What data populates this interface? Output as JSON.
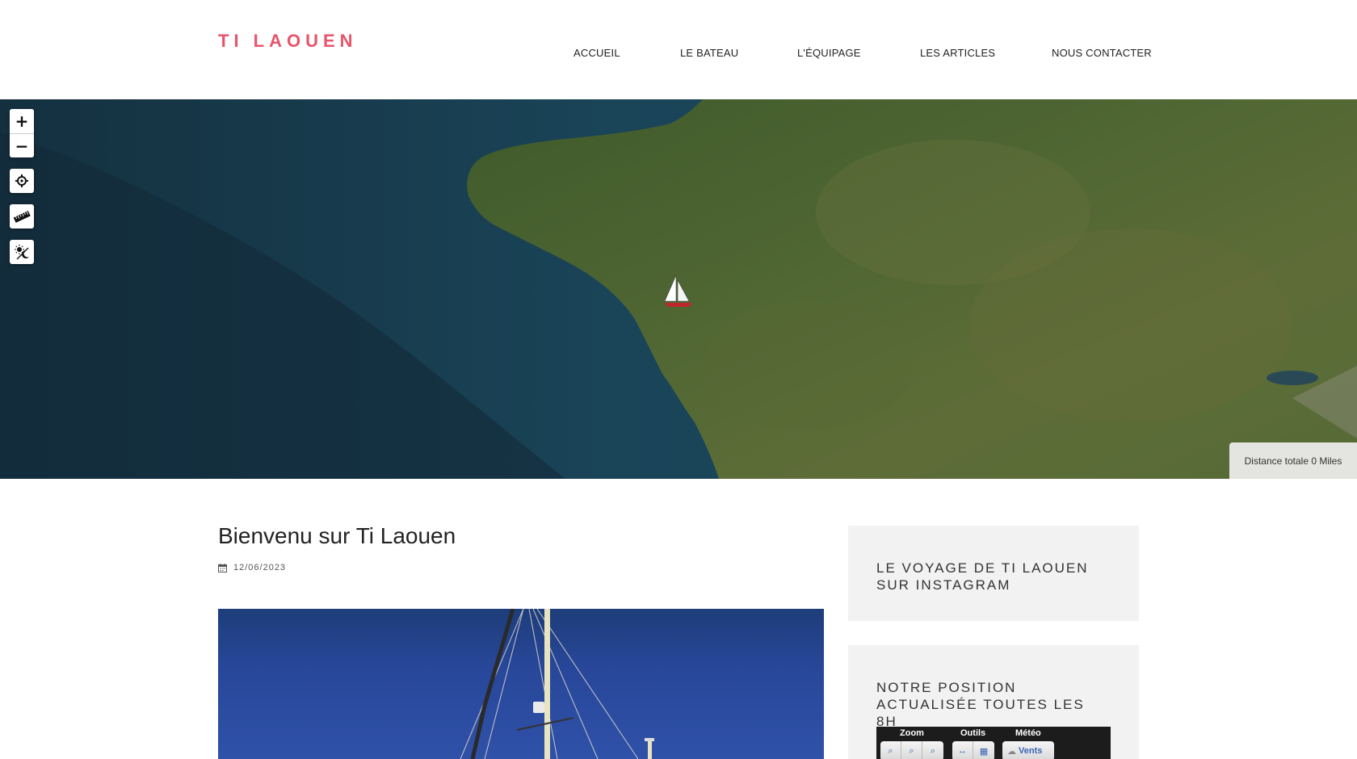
{
  "site": {
    "logo": "TI LAOUEN"
  },
  "nav": {
    "items": [
      {
        "label": "ACCUEIL"
      },
      {
        "label": "LE BATEAU"
      },
      {
        "label": "L'ÉQUIPAGE"
      },
      {
        "label": "LES ARTICLES"
      },
      {
        "label": "NOUS CONTACTER"
      }
    ]
  },
  "map": {
    "zoom_in": "+",
    "zoom_out": "−",
    "distance_label": "Distance totale 0 Miles"
  },
  "post": {
    "title": "Bienvenu sur Ti Laouen",
    "date": "12/06/2023"
  },
  "sidebar": {
    "instagram_title": "LE VOYAGE DE TI LAOUEN SUR INSTAGRAM",
    "position_title": "NOTRE POSITION ACTUALISÉE TOUTES LES 8H",
    "embed": {
      "zoom_label": "Zoom",
      "tools_label": "Outils",
      "weather_label": "Météo",
      "vents_label": "Vents"
    }
  },
  "colors": {
    "brand": "#e8546a",
    "sea": "#1a3d52",
    "land": "#4d6530",
    "widget_bg": "#f2f2f2"
  }
}
